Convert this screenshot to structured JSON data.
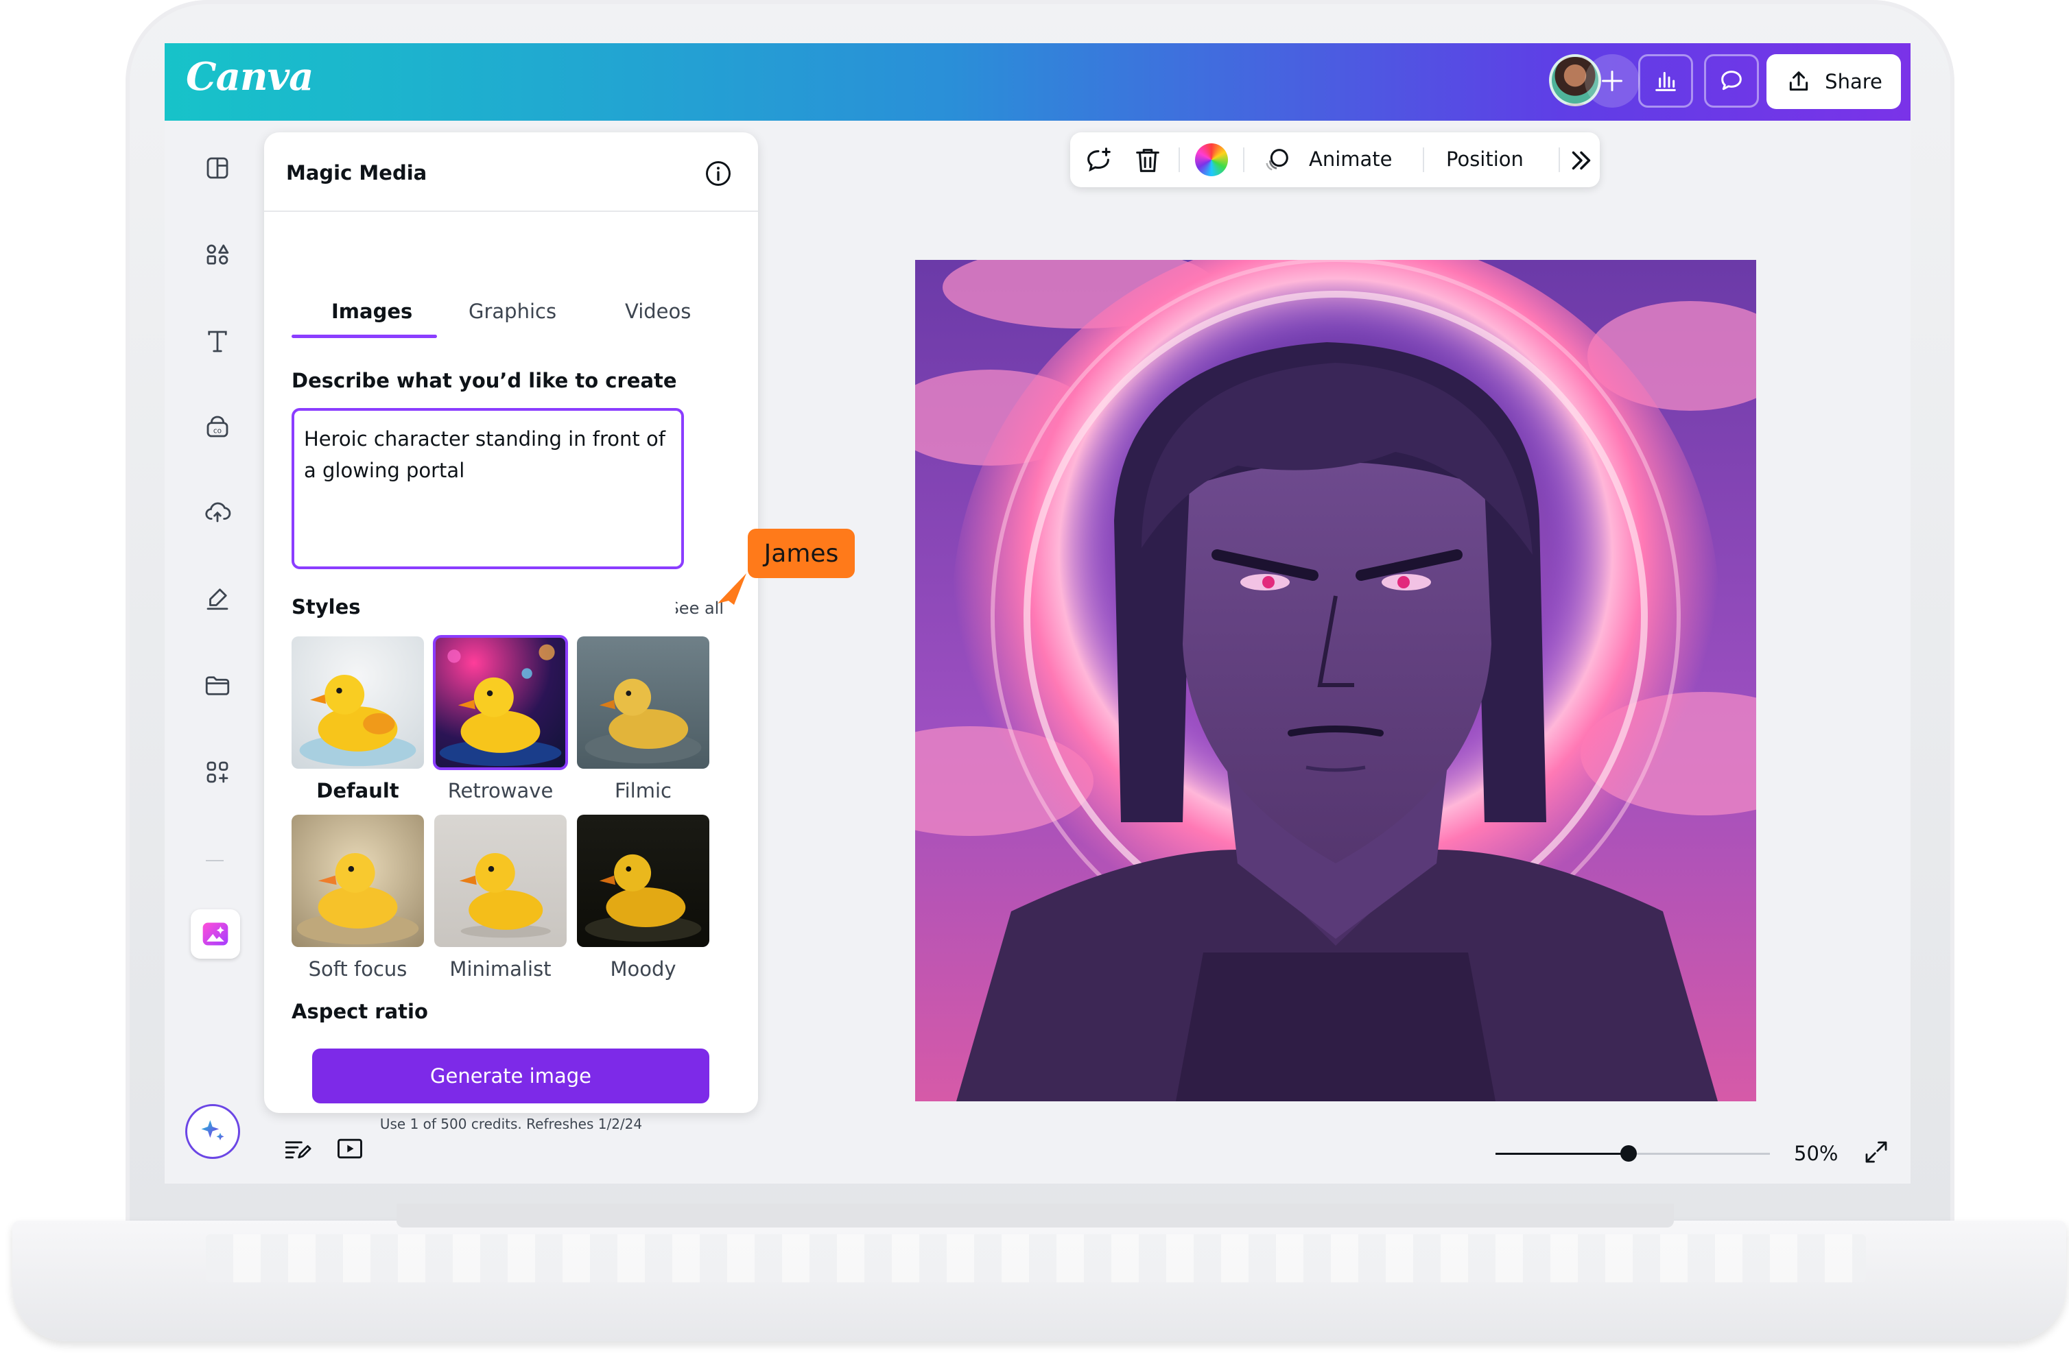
{
  "app": {
    "logo": "Canva",
    "share_label": "Share"
  },
  "panel": {
    "title": "Magic Media",
    "tabs": [
      {
        "label": "Images",
        "active": true
      },
      {
        "label": "Graphics"
      },
      {
        "label": "Videos"
      }
    ],
    "describe_label": "Describe what you’d like to create",
    "prompt_value": "Heroic character standing in front of a glowing portal",
    "styles_label": "Styles",
    "see_all": "See all",
    "styles": [
      {
        "label": "Default",
        "selected_text": true
      },
      {
        "label": "Retrowave",
        "selected": true
      },
      {
        "label": "Filmic"
      },
      {
        "label": "Soft focus"
      },
      {
        "label": "Minimalist"
      },
      {
        "label": "Moody"
      }
    ],
    "aspect_ratio_label": "Aspect ratio",
    "generate_label": "Generate image",
    "credits_text": "Use 1 of 500 credits. Refreshes 1/2/24"
  },
  "cursor_tag": {
    "name": "James",
    "color": "#ff7a1a"
  },
  "toolbar": {
    "animate_label": "Animate",
    "position_label": "Position"
  },
  "zoom": {
    "value": 50,
    "label": "50%"
  },
  "colors": {
    "accent": "#8b3dff",
    "button": "#7d2ae8"
  }
}
